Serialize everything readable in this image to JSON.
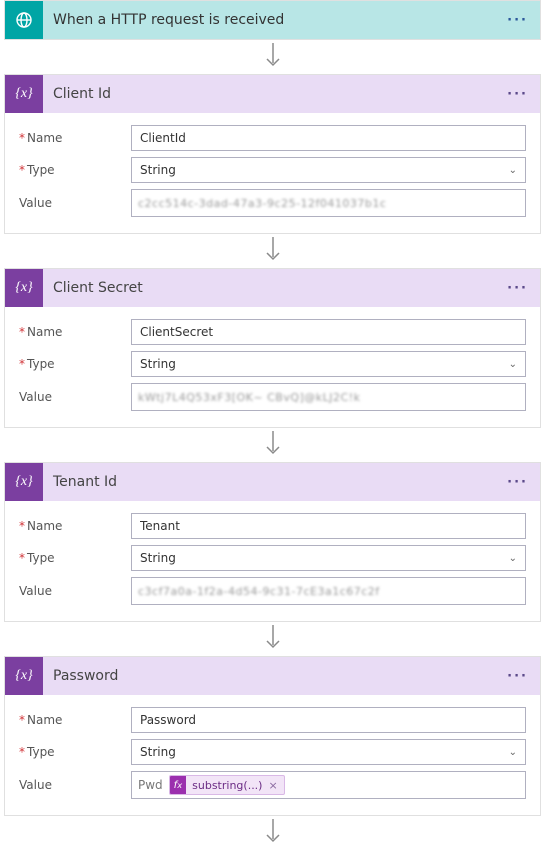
{
  "trigger": {
    "title": "When a HTTP request is received",
    "icon": "globe-http-icon"
  },
  "labels": {
    "name": "Name",
    "type": "Type",
    "value": "Value"
  },
  "actions": [
    {
      "title": "Client Id",
      "name_value": "ClientId",
      "type_value": "String",
      "value_kind": "masked",
      "value_text": "c2cc514c-3dad-47a3-9c25-12f041037b1c"
    },
    {
      "title": "Client Secret",
      "name_value": "ClientSecret",
      "type_value": "String",
      "value_kind": "masked",
      "value_text": "kWtj7L4Q53xF3[OK~  CBvQ]@kLJ2C!k"
    },
    {
      "title": "Tenant Id",
      "name_value": "Tenant",
      "type_value": "String",
      "value_kind": "masked",
      "value_text": "c3cf7a0a-1f2a-4d54-9c31-7cE3a1c67c2f"
    },
    {
      "title": "Password",
      "name_value": "Password",
      "type_value": "String",
      "value_kind": "token",
      "value_prefix": "Pwd",
      "token_label": "substring(...)"
    }
  ]
}
